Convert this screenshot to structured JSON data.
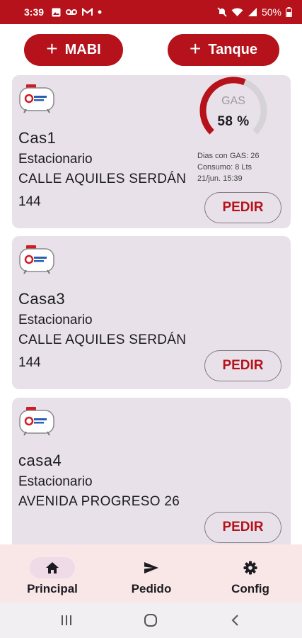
{
  "status_bar": {
    "time": "3:39",
    "battery": "50%",
    "icons": [
      "image-icon",
      "voicemail-icon",
      "gmail-icon",
      "dot-icon",
      "mute-icon",
      "wifi-icon",
      "signal-icon",
      "battery-icon"
    ]
  },
  "actions": {
    "add_mabi": "MABI",
    "add_tanque": "Tanque",
    "plus": "+"
  },
  "cards": [
    {
      "name": "Cas1",
      "type": "Estacionario",
      "address_line1": "CALLE AQUILES SERDÁN",
      "address_line2": "144",
      "button": "PEDIR",
      "gauge": {
        "label": "GAS",
        "percent_text": "58 %",
        "level": 0.58
      },
      "info": {
        "dias": "Dias con GAS: 26",
        "consumo": "Consumo: 8 Lts",
        "fecha": "21/jun. 15:39"
      }
    },
    {
      "name": "Casa3",
      "type": "Estacionario",
      "address_line1": "CALLE AQUILES SERDÁN",
      "address_line2": "144",
      "button": "PEDIR"
    },
    {
      "name": "casa4",
      "type": "Estacionario",
      "address_line1": "AVENIDA PROGRESO 26",
      "address_line2": "",
      "button": "PEDIR"
    }
  ],
  "bottom_nav": {
    "items": [
      {
        "label": "Principal",
        "icon": "home-icon",
        "active": true
      },
      {
        "label": "Pedido",
        "icon": "send-icon",
        "active": false
      },
      {
        "label": "Config",
        "icon": "gear-icon",
        "active": false
      }
    ]
  },
  "colors": {
    "brand": "#b5121b",
    "card_bg": "#e8e1e9",
    "nav_bg": "#f9e7e8",
    "gauge_track": "#d6d3d8"
  }
}
